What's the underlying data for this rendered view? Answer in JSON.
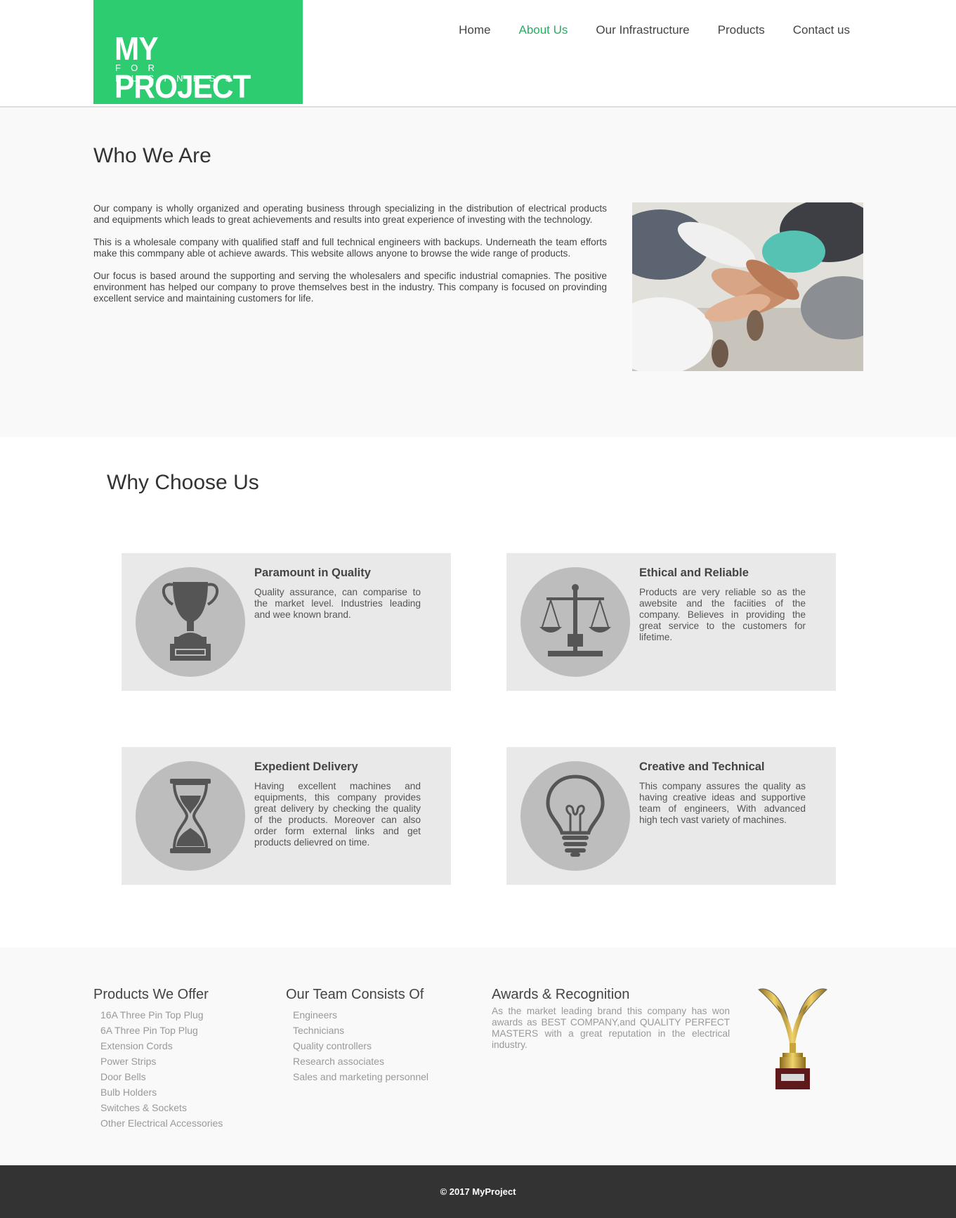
{
  "logo": {
    "title": "MY PROJECT",
    "subtitle": "FOR BUSINESS"
  },
  "nav": [
    {
      "label": "Home",
      "active": false
    },
    {
      "label": "About Us",
      "active": true
    },
    {
      "label": "Our Infrastructure",
      "active": false
    },
    {
      "label": "Products",
      "active": false
    },
    {
      "label": "Contact us",
      "active": false
    }
  ],
  "who": {
    "title": "Who We Are",
    "paragraphs": [
      "Our company is wholly organized and operating business through specializing in the distribution of electrical products and equipments which leads to great achievements and results into great experience of investing with the technology.",
      "This is a wholesale company with qualified staff and full technical engineers with backups. Underneath the team efforts make this commpany able ot achieve awards. This website allows anyone to browse the wide range of products.",
      "Our focus is based around the supporting and serving the wholesalers and specific industrial comapnies. The positive environment has helped our company to prove themselves best in the industry. This company is focused on provinding excellent service and maintaining customers for life."
    ],
    "image_icon": "team-hands-photo"
  },
  "why": {
    "title": "Why Choose Us",
    "cards": [
      {
        "title": "Paramount in Quality",
        "text": "Quality assurance, can comparise to the market level. Industries leading and wee known brand.",
        "icon": "trophy-icon"
      },
      {
        "title": "Ethical and Reliable",
        "text": "Products are very reliable so as the awebsite and the faciities of the company. Believes in providing the great service to the customers for lifetime.",
        "icon": "scales-icon"
      },
      {
        "title": "Expedient Delivery",
        "text": "Having excellent machines and equipments, this company provides great delivery by checking the quality of the products. Moreover can also order form external links and get products delievred on time.",
        "icon": "hourglass-icon"
      },
      {
        "title": "Creative and Technical",
        "text": "This company assures the quality as having creative ideas and supportive team of engineers, With advanced high tech vast variety of machines.",
        "icon": "lightbulb-icon"
      }
    ]
  },
  "footer": {
    "products": {
      "title": "Products We Offer",
      "items": [
        "16A Three Pin Top Plug",
        "6A Three Pin Top Plug",
        "Extension Cords",
        "Power Strips",
        "Door Bells",
        "Bulb Holders",
        "Switches & Sockets",
        "Other Electrical Accessories"
      ]
    },
    "team": {
      "title": "Our Team Consists Of",
      "items": [
        "Engineers",
        "Technicians",
        "Quality controllers",
        "Research associates",
        "Sales and marketing personnel"
      ]
    },
    "awards": {
      "title": "Awards & Recognition",
      "text": "As the market leading brand this company has won awards as BEST COMPANY,and QUALITY PERFECT MASTERS with a great reputation in the electrical industry.",
      "icon": "gold-trophy-icon"
    }
  },
  "copyright": "© 2017 MyProject",
  "colors": {
    "accent": "#2ecc71",
    "nav_active": "#27ae60",
    "footer_bar": "#333333",
    "card_bg": "#e9e9e9",
    "icon_circle": "#bdbdbd"
  }
}
